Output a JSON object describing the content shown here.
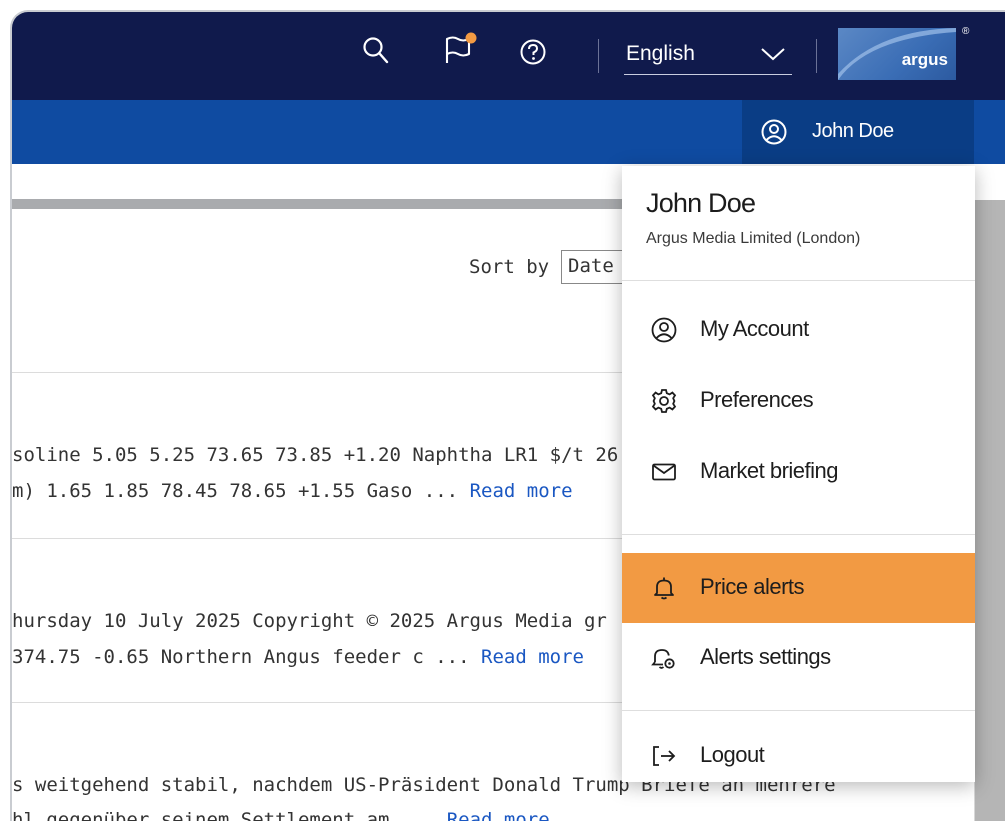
{
  "header": {
    "language": "English",
    "logo_text": "argus",
    "logo_mark": "®",
    "icons": [
      "search-icon",
      "flag-icon",
      "help-icon",
      "chevron-down-icon"
    ],
    "notification_dot_color": "#f29a43"
  },
  "nav": {
    "user_name": "John Doe"
  },
  "results": {
    "sort_label": "Sort by",
    "sort_value": "Date",
    "items": [
      {
        "line1": "soline 5.05 5.25 73.65 73.85 +1.20 Naphtha LR1 $/t 26",
        "line2": "m) 1.65 1.85 78.45 78.65 +1.55 Gaso ...",
        "read_more": "Read more"
      },
      {
        "line1": "hursday 10 July 2025 Copyright © 2025 Argus Media gr",
        "line2": "374.75 -0.65 Northern Angus feeder c ...",
        "read_more": "Read more"
      },
      {
        "line1": "s weitgehend stabil, nachdem US-Präsident Donald Trump Briefe an mehrere",
        "line2": "hl gegenüber seinem Settlement am ...",
        "read_more": "Read more"
      }
    ]
  },
  "user_menu": {
    "name": "John Doe",
    "organization": "Argus Media Limited (London)",
    "items": [
      {
        "label": "My Account",
        "icon": "user-circle-icon"
      },
      {
        "label": "Preferences",
        "icon": "gear-icon"
      },
      {
        "label": "Market briefing",
        "icon": "mail-icon"
      },
      {
        "label": "Price alerts",
        "icon": "bell-icon",
        "active": true
      },
      {
        "label": "Alerts settings",
        "icon": "bell-settings-icon"
      },
      {
        "label": "Logout",
        "icon": "logout-icon"
      }
    ]
  },
  "colors": {
    "topbar": "#101a4c",
    "navbar": "#0f4ba1",
    "accent": "#f29a43",
    "link": "#1a57c2"
  }
}
